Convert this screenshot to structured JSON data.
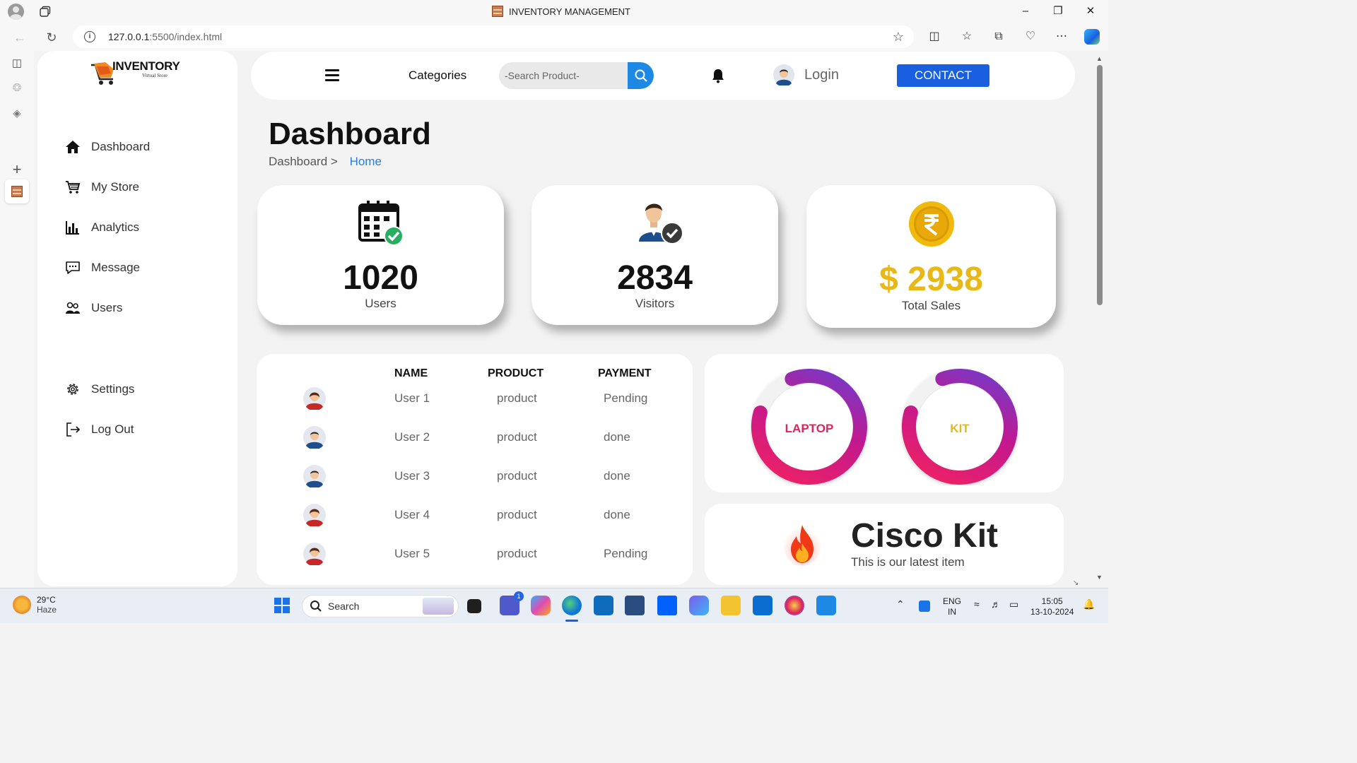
{
  "browser": {
    "window_title": "INVENTORY MANAGEMENT",
    "url_host": "127.0.0.1",
    "url_path": ":5500/index.html"
  },
  "app": {
    "logo": {
      "brand": "INVENTORY",
      "tagline": "Virtual Store"
    },
    "sidebar": {
      "items": [
        {
          "label": "Dashboard",
          "icon": "home-icon"
        },
        {
          "label": "My Store",
          "icon": "cart-icon"
        },
        {
          "label": "Analytics",
          "icon": "bar-chart-icon"
        },
        {
          "label": "Message",
          "icon": "chat-icon"
        },
        {
          "label": "Users",
          "icon": "users-icon"
        }
      ],
      "bottom_items": [
        {
          "label": "Settings",
          "icon": "gear-icon"
        },
        {
          "label": "Log Out",
          "icon": "logout-icon"
        }
      ]
    },
    "topbar": {
      "categories_label": "Categories",
      "search_placeholder": "-Search Product-",
      "login_label": "Login",
      "contact_label": "CONTACT"
    },
    "page": {
      "title": "Dashboard",
      "breadcrumb_parent": "Dashboard >",
      "breadcrumb_current": "Home"
    },
    "stats": [
      {
        "value": "1020",
        "label": "Users",
        "icon": "calendar-check-icon"
      },
      {
        "value": "2834",
        "label": "Visitors",
        "icon": "user-check-icon"
      },
      {
        "value": "$ 2938",
        "label": "Total Sales",
        "icon": "rupee-coin-icon",
        "value_color": "#e8b817"
      }
    ],
    "table": {
      "headers": [
        "NAME",
        "PRODUCT",
        "PAYMENT"
      ],
      "rows": [
        {
          "name": "User 1",
          "product": "product",
          "payment": "Pending",
          "avatar": "female-avatar"
        },
        {
          "name": "User 2",
          "product": "product",
          "payment": "done",
          "avatar": "male-avatar"
        },
        {
          "name": "User 3",
          "product": "product",
          "payment": "done",
          "avatar": "male-avatar"
        },
        {
          "name": "User 4",
          "product": "product",
          "payment": "done",
          "avatar": "female-avatar"
        },
        {
          "name": "User 5",
          "product": "product",
          "payment": "Pending",
          "avatar": "female-avatar"
        }
      ]
    },
    "donuts": [
      {
        "label": "LAPTOP",
        "label_color": "#e0245e",
        "progress": 0.85
      },
      {
        "label": "KIT",
        "label_color": "#e8b817",
        "progress": 0.85
      }
    ],
    "promo": {
      "title": "Cisco Kit",
      "subtitle": "This is our latest item"
    }
  },
  "taskbar": {
    "weather_temp": "29°C",
    "weather_desc": "Haze",
    "search_label": "Search",
    "lang": "ENG",
    "region": "IN",
    "time": "15:05",
    "date": "13-10-2024",
    "teams_badge": "1"
  }
}
